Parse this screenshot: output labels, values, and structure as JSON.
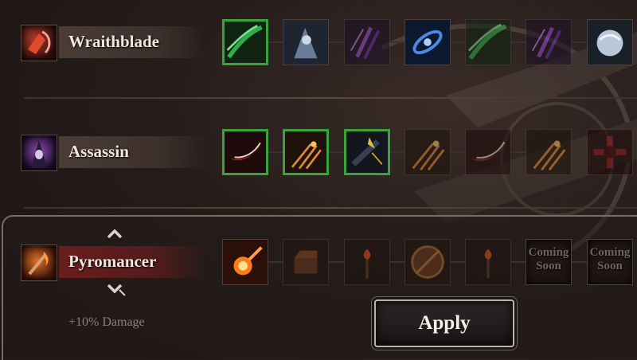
{
  "classes": [
    {
      "name": "Wraithblade",
      "icon": "wraithblade-portrait-icon",
      "skills": [
        {
          "icon": "green-wind-slash-icon",
          "selected": true
        },
        {
          "icon": "hooded-assault-icon",
          "selected": false
        },
        {
          "icon": "purple-claw-icon",
          "selected": false
        },
        {
          "icon": "blue-vortex-icon",
          "selected": false
        },
        {
          "icon": "green-wind-slash-icon",
          "selected": false
        },
        {
          "icon": "purple-claw-icon",
          "selected": false
        },
        {
          "icon": "spirit-globe-icon",
          "selected": false
        }
      ]
    },
    {
      "name": "Assassin",
      "icon": "assassin-portrait-icon",
      "skills": [
        {
          "icon": "crimson-blade-icon",
          "selected": true
        },
        {
          "icon": "fire-shuriken-icon",
          "selected": true
        },
        {
          "icon": "dark-daggers-icon",
          "selected": true
        },
        {
          "icon": "fire-shuriken-icon",
          "selected": false
        },
        {
          "icon": "crimson-blade-icon",
          "selected": false
        },
        {
          "icon": "fire-shuriken-icon",
          "selected": false
        },
        {
          "icon": "blood-cross-icon",
          "selected": false
        }
      ]
    },
    {
      "name": "Pyromancer",
      "icon": "pyromancer-portrait-icon",
      "active": true,
      "skills": [
        {
          "icon": "fireball-icon",
          "selected": false,
          "unlocked": true
        },
        {
          "icon": "fire-chest-icon",
          "selected": false
        },
        {
          "icon": "torch-flame-icon",
          "selected": false
        },
        {
          "icon": "fire-shield-icon",
          "selected": false
        },
        {
          "icon": "torch-flame-icon",
          "selected": false
        },
        {
          "coming_soon": "Coming Soon"
        },
        {
          "coming_soon": "Coming Soon"
        }
      ]
    }
  ],
  "pyromancer_bonus": "+10% Damage",
  "apply_label": "Apply",
  "colors": {
    "selected_border": "#3aa43a",
    "active_plate": "#6e1e1e",
    "text": "#efe7df"
  }
}
